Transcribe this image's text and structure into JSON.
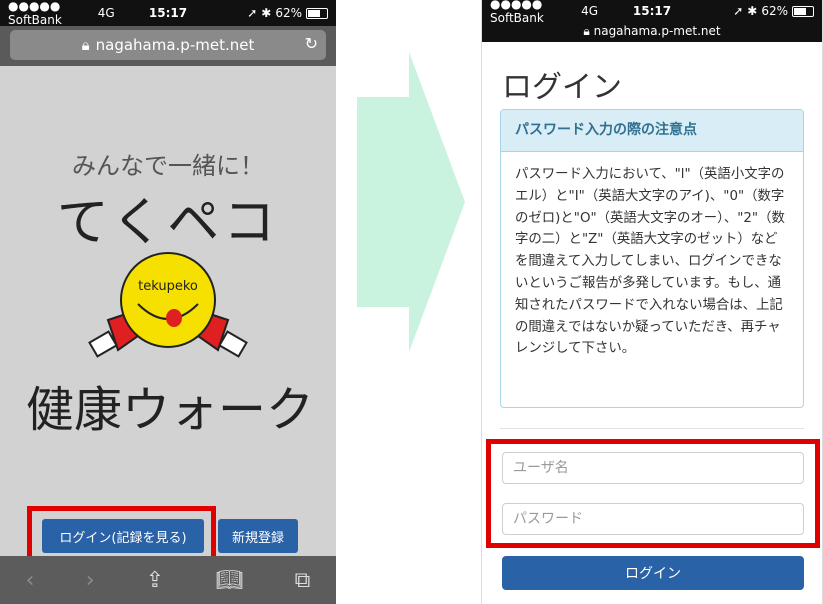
{
  "left_phone": {
    "status": {
      "carrier": "●●●●● SoftBank",
      "network": "4G",
      "time": "15:17",
      "battery": "62%"
    },
    "url": "nagahama.p-met.net",
    "subtitle": "みんなで一緒に！",
    "title": "てくペコ",
    "mascot_text": "tekupeko",
    "title2": "健康ウォーク",
    "login_button": "ログイン(記録を見る)",
    "register_button": "新規登録",
    "toolbar_icons": [
      "back-icon",
      "forward-icon",
      "share-icon",
      "bookmarks-icon",
      "tabs-icon"
    ]
  },
  "right_phone": {
    "status": {
      "carrier": "●●●●● SoftBank",
      "network": "4G",
      "time": "15:17",
      "battery": "62%"
    },
    "url": "nagahama.p-met.net",
    "page_title": "ログイン",
    "notice": {
      "heading": "パスワード入力の際の注意点",
      "body": "パスワード入力において、\"l\"（英語小文字のエル）と\"I\"（英語大文字のアイ)、\"0\"（数字のゼロ)と\"O\"（英語大文字のオー）、\"2\"（数字の二）と\"Z\"（英語大文字のゼット）などを間違えて入力してしまい、ログインできないというご報告が多発しています。もし、通知されたパスワードで入れない場合は、上記の間違えではないか疑っていただき、再チャレンジして下さい。"
    },
    "username_placeholder": "ユーザ名",
    "password_placeholder": "パスワード",
    "login_button": "ログイン"
  },
  "colors": {
    "primary_button": "#2a62a8",
    "highlight": "#e00000",
    "arrow": "#c9f3de",
    "notice_heading_bg": "#d9edf7"
  }
}
